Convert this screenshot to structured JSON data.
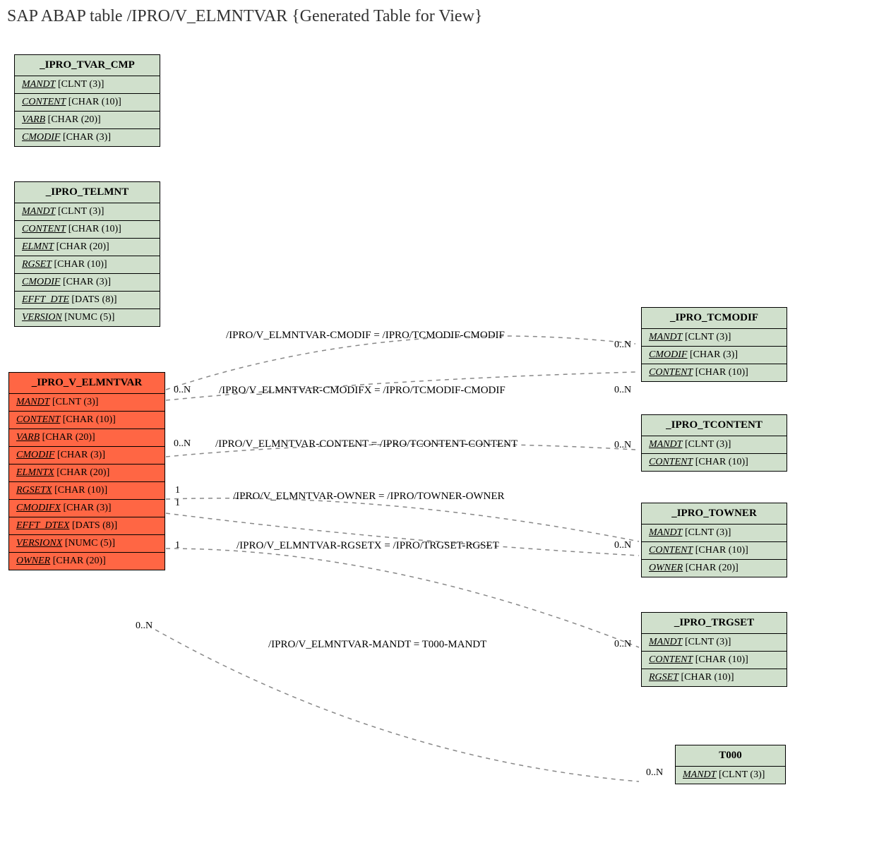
{
  "title": "SAP ABAP table /IPRO/V_ELMNTVAR {Generated Table for View}",
  "entities": {
    "tvar_cmp": {
      "name": "_IPRO_TVAR_CMP",
      "rows": [
        {
          "key": "MANDT",
          "type": "[CLNT (3)]"
        },
        {
          "key": "CONTENT",
          "type": "[CHAR (10)]"
        },
        {
          "key": "VARB",
          "type": "[CHAR (20)]"
        },
        {
          "key": "CMODIF",
          "type": "[CHAR (3)]"
        }
      ]
    },
    "telmnt": {
      "name": "_IPRO_TELMNT",
      "rows": [
        {
          "key": "MANDT",
          "type": "[CLNT (3)]"
        },
        {
          "key": "CONTENT",
          "type": "[CHAR (10)]"
        },
        {
          "key": "ELMNT",
          "type": "[CHAR (20)]"
        },
        {
          "key": "RGSET",
          "type": "[CHAR (10)]"
        },
        {
          "key": "CMODIF",
          "type": "[CHAR (3)]"
        },
        {
          "key": "EFFT_DTE",
          "type": "[DATS (8)]"
        },
        {
          "key": "VERSION",
          "type": "[NUMC (5)]"
        }
      ]
    },
    "v_elmntvar": {
      "name": "_IPRO_V_ELMNTVAR",
      "rows": [
        {
          "key": "MANDT",
          "type": "[CLNT (3)]"
        },
        {
          "key": "CONTENT",
          "type": "[CHAR (10)]"
        },
        {
          "key": "VARB",
          "type": "[CHAR (20)]"
        },
        {
          "key": "CMODIF",
          "type": "[CHAR (3)]"
        },
        {
          "key": "ELMNTX",
          "type": "[CHAR (20)]"
        },
        {
          "key": "RGSETX",
          "type": "[CHAR (10)]"
        },
        {
          "key": "CMODIFX",
          "type": "[CHAR (3)]"
        },
        {
          "key": "EFFT_DTEX",
          "type": "[DATS (8)]"
        },
        {
          "key": "VERSIONX",
          "type": "[NUMC (5)]"
        },
        {
          "key": "OWNER",
          "type": "[CHAR (20)]"
        }
      ]
    },
    "tcmodif": {
      "name": "_IPRO_TCMODIF",
      "rows": [
        {
          "key": "MANDT",
          "type": "[CLNT (3)]"
        },
        {
          "key": "CMODIF",
          "type": "[CHAR (3)]"
        },
        {
          "key": "CONTENT",
          "type": "[CHAR (10)]"
        }
      ]
    },
    "tcontent": {
      "name": "_IPRO_TCONTENT",
      "rows": [
        {
          "key": "MANDT",
          "type": "[CLNT (3)]"
        },
        {
          "key": "CONTENT",
          "type": "[CHAR (10)]"
        }
      ]
    },
    "towner": {
      "name": "_IPRO_TOWNER",
      "rows": [
        {
          "key": "MANDT",
          "type": "[CLNT (3)]"
        },
        {
          "key": "CONTENT",
          "type": "[CHAR (10)]"
        },
        {
          "key": "OWNER",
          "type": "[CHAR (20)]"
        }
      ]
    },
    "trgset": {
      "name": "_IPRO_TRGSET",
      "rows": [
        {
          "key": "MANDT",
          "type": "[CLNT (3)]"
        },
        {
          "key": "CONTENT",
          "type": "[CHAR (10)]"
        },
        {
          "key": "RGSET",
          "type": "[CHAR (10)]"
        }
      ]
    },
    "t000": {
      "name": "T000",
      "rows": [
        {
          "key": "MANDT",
          "type": "[CLNT (3)]"
        }
      ]
    }
  },
  "relations": {
    "r1": {
      "text": "/IPRO/V_ELMNTVAR-CMODIF = /IPRO/TCMODIF-CMODIF",
      "left_card": "",
      "right_card": "0..N"
    },
    "r2": {
      "text": "/IPRO/V_ELMNTVAR-CMODIFX = /IPRO/TCMODIF-CMODIF",
      "left_card": "0..N",
      "right_card": "0..N"
    },
    "r3": {
      "text": "/IPRO/V_ELMNTVAR-CONTENT = /IPRO/TCONTENT-CONTENT",
      "left_card": "0..N",
      "right_card": "0..N"
    },
    "r4": {
      "text": "/IPRO/V_ELMNTVAR-OWNER = /IPRO/TOWNER-OWNER",
      "left_card_a": "1",
      "left_card_b": "1",
      "right_card": ""
    },
    "r5": {
      "text": "/IPRO/V_ELMNTVAR-RGSETX = /IPRO/TRGSET-RGSET",
      "left_card": "1",
      "right_card": "0..N"
    },
    "r6": {
      "text": "/IPRO/V_ELMNTVAR-MANDT = T000-MANDT",
      "left_card": "0..N",
      "right_card": "0..N"
    }
  }
}
